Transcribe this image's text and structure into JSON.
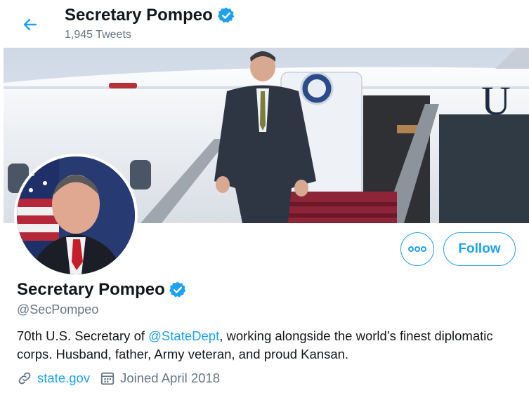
{
  "header": {
    "back_icon": "arrow-left-icon",
    "name": "Secretary Pompeo",
    "verified_icon": "verified-badge-icon",
    "tweet_count": "1,945 Tweets"
  },
  "banner": {
    "description_icon": "banner-photo"
  },
  "profile": {
    "name": "Secretary Pompeo",
    "handle": "@SecPompeo",
    "bio_before": "70th U.S. Secretary of ",
    "bio_mention": "@StateDept",
    "bio_after": ", working alongside the world’s finest diplomatic corps. Husband, father, Army veteran, and proud Kansan.",
    "website": "state.gov",
    "joined": "Joined April 2018"
  },
  "actions": {
    "more_icon": "more-dots-icon",
    "follow_label": "Follow"
  },
  "colors": {
    "accent": "#1da1f2",
    "secondary_text": "#657786",
    "primary_text": "#14171a"
  }
}
